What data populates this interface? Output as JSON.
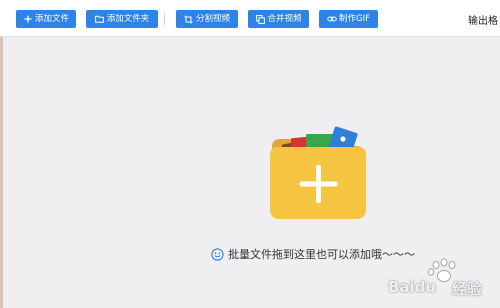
{
  "toolbar": {
    "add_file": "添加文件",
    "add_folder": "添加文件夹",
    "split_video": "分割视频",
    "merge_video": "合并视频",
    "make_gif": "制作GIF",
    "output_format": "输出格"
  },
  "drop_zone": {
    "hint": "批量文件拖到这里也可以添加哦～～～"
  },
  "watermark": {
    "brand": "Baidu",
    "suffix": "经验"
  },
  "colors": {
    "button_blue": "#2d83e8",
    "background": "#efeff1",
    "folder_yellow": "#f5c542"
  },
  "icons": {
    "add_file": "plus-icon",
    "add_folder": "folder-icon",
    "split_video": "crop-icon",
    "merge_video": "copy-icon",
    "make_gif": "link-icon",
    "hint": "smile-icon",
    "drop": "folder-plus-icon"
  }
}
